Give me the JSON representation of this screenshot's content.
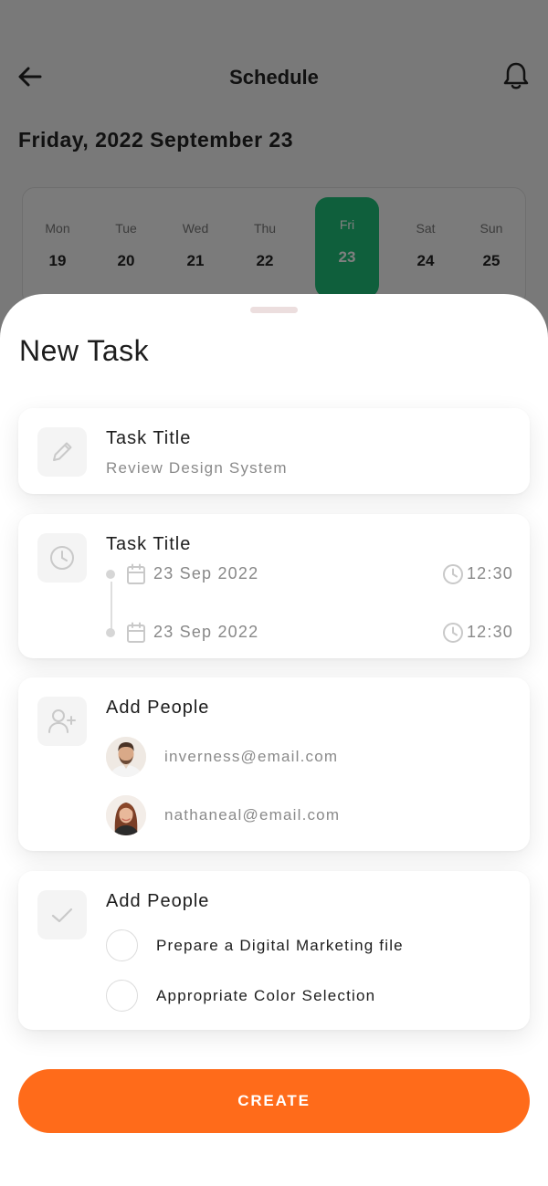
{
  "background": {
    "title": "Schedule",
    "date": "Friday, 2022 September 23",
    "week": [
      {
        "name": "Mon",
        "num": "19"
      },
      {
        "name": "Tue",
        "num": "20"
      },
      {
        "name": "Wed",
        "num": "21"
      },
      {
        "name": "Thu",
        "num": "22"
      },
      {
        "name": "Fri",
        "num": "23"
      },
      {
        "name": "Sat",
        "num": "24"
      },
      {
        "name": "Sun",
        "num": "25"
      }
    ],
    "active_day_color": "#1fbf78"
  },
  "sheet": {
    "title": "New Task",
    "title_card": {
      "icon": "pencil-icon",
      "label": "Task Title",
      "value": "Review Design System"
    },
    "date_card": {
      "icon": "clock-icon",
      "label": "Task Title",
      "start": {
        "date": "23 Sep 2022",
        "time": "12:30"
      },
      "end": {
        "date": "23 Sep 2022",
        "time": "12:30"
      }
    },
    "people_card": {
      "icon": "add-user-icon",
      "label": "Add People",
      "people": [
        {
          "email": "inverness@email.com",
          "avatar": "male-avatar"
        },
        {
          "email": "nathaneal@email.com",
          "avatar": "female-avatar"
        }
      ]
    },
    "checklist_card": {
      "icon": "checkmark-icon",
      "label": "Add People",
      "items": [
        {
          "text": "Prepare a Digital Marketing file",
          "checked": false
        },
        {
          "text": "Appropriate Color Selection",
          "checked": false
        }
      ]
    },
    "create_label": "CREATE"
  },
  "colors": {
    "accent": "#ff6b1a",
    "text": "#1d1d1d",
    "muted": "#8a8a8a"
  }
}
